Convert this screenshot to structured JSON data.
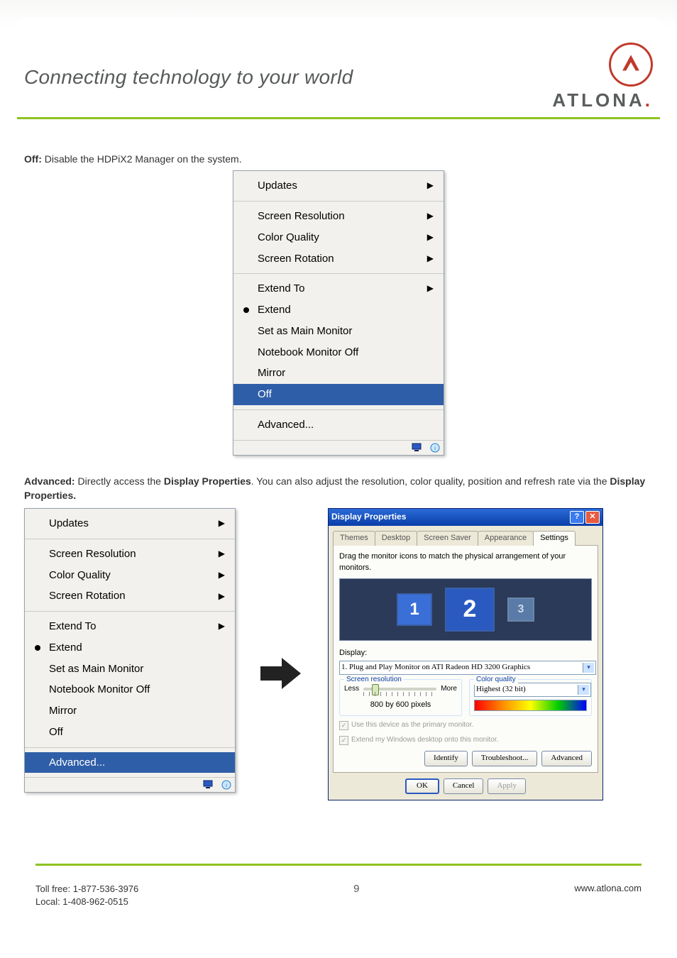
{
  "header": {
    "tagline": "Connecting technology to your world",
    "brand": "ATLONA",
    "brand_dot": "."
  },
  "body": {
    "off_label": "Off:",
    "off_text": " Disable the HDPiX2 Manager on the system.",
    "adv_label": "Advanced:",
    "adv_text_1": " Directly access the ",
    "adv_bold_1": "Display Properties",
    "adv_text_2": ". You can also adjust the resolution, color quality, position and refresh rate via the ",
    "adv_bold_2": "Display Properties."
  },
  "menu": {
    "updates": "Updates",
    "screen_resolution": "Screen Resolution",
    "color_quality": "Color Quality",
    "screen_rotation": "Screen Rotation",
    "extend_to": "Extend To",
    "extend": "Extend",
    "set_main": "Set as Main Monitor",
    "nb_off": "Notebook Monitor Off",
    "mirror": "Mirror",
    "off": "Off",
    "advanced": "Advanced...",
    "arrow": "▶"
  },
  "dp": {
    "title": "Display Properties",
    "tabs": [
      "Themes",
      "Desktop",
      "Screen Saver",
      "Appearance",
      "Settings"
    ],
    "active_tab": 4,
    "drag_text": "Drag the monitor icons to match the physical arrangement of your monitors.",
    "monitors": [
      "1",
      "2",
      "3"
    ],
    "display_label": "Display:",
    "display_value": "1. Plug and Play Monitor on ATI Radeon HD 3200 Graphics",
    "sr_title": "Screen resolution",
    "sr_less": "Less",
    "sr_more": "More",
    "sr_value": "800 by 600 pixels",
    "cq_title": "Color quality",
    "cq_value": "Highest (32 bit)",
    "chk1": "Use this device as the primary monitor.",
    "chk2": "Extend my Windows desktop onto this monitor.",
    "btn_identify": "Identify",
    "btn_trouble": "Troubleshoot...",
    "btn_adv": "Advanced",
    "btn_ok": "OK",
    "btn_cancel": "Cancel",
    "btn_apply": "Apply"
  },
  "footer": {
    "tollfree": "Toll free: 1-877-536-3976",
    "local": "Local: 1-408-962-0515",
    "page": "9",
    "url": "www.atlona.com"
  }
}
